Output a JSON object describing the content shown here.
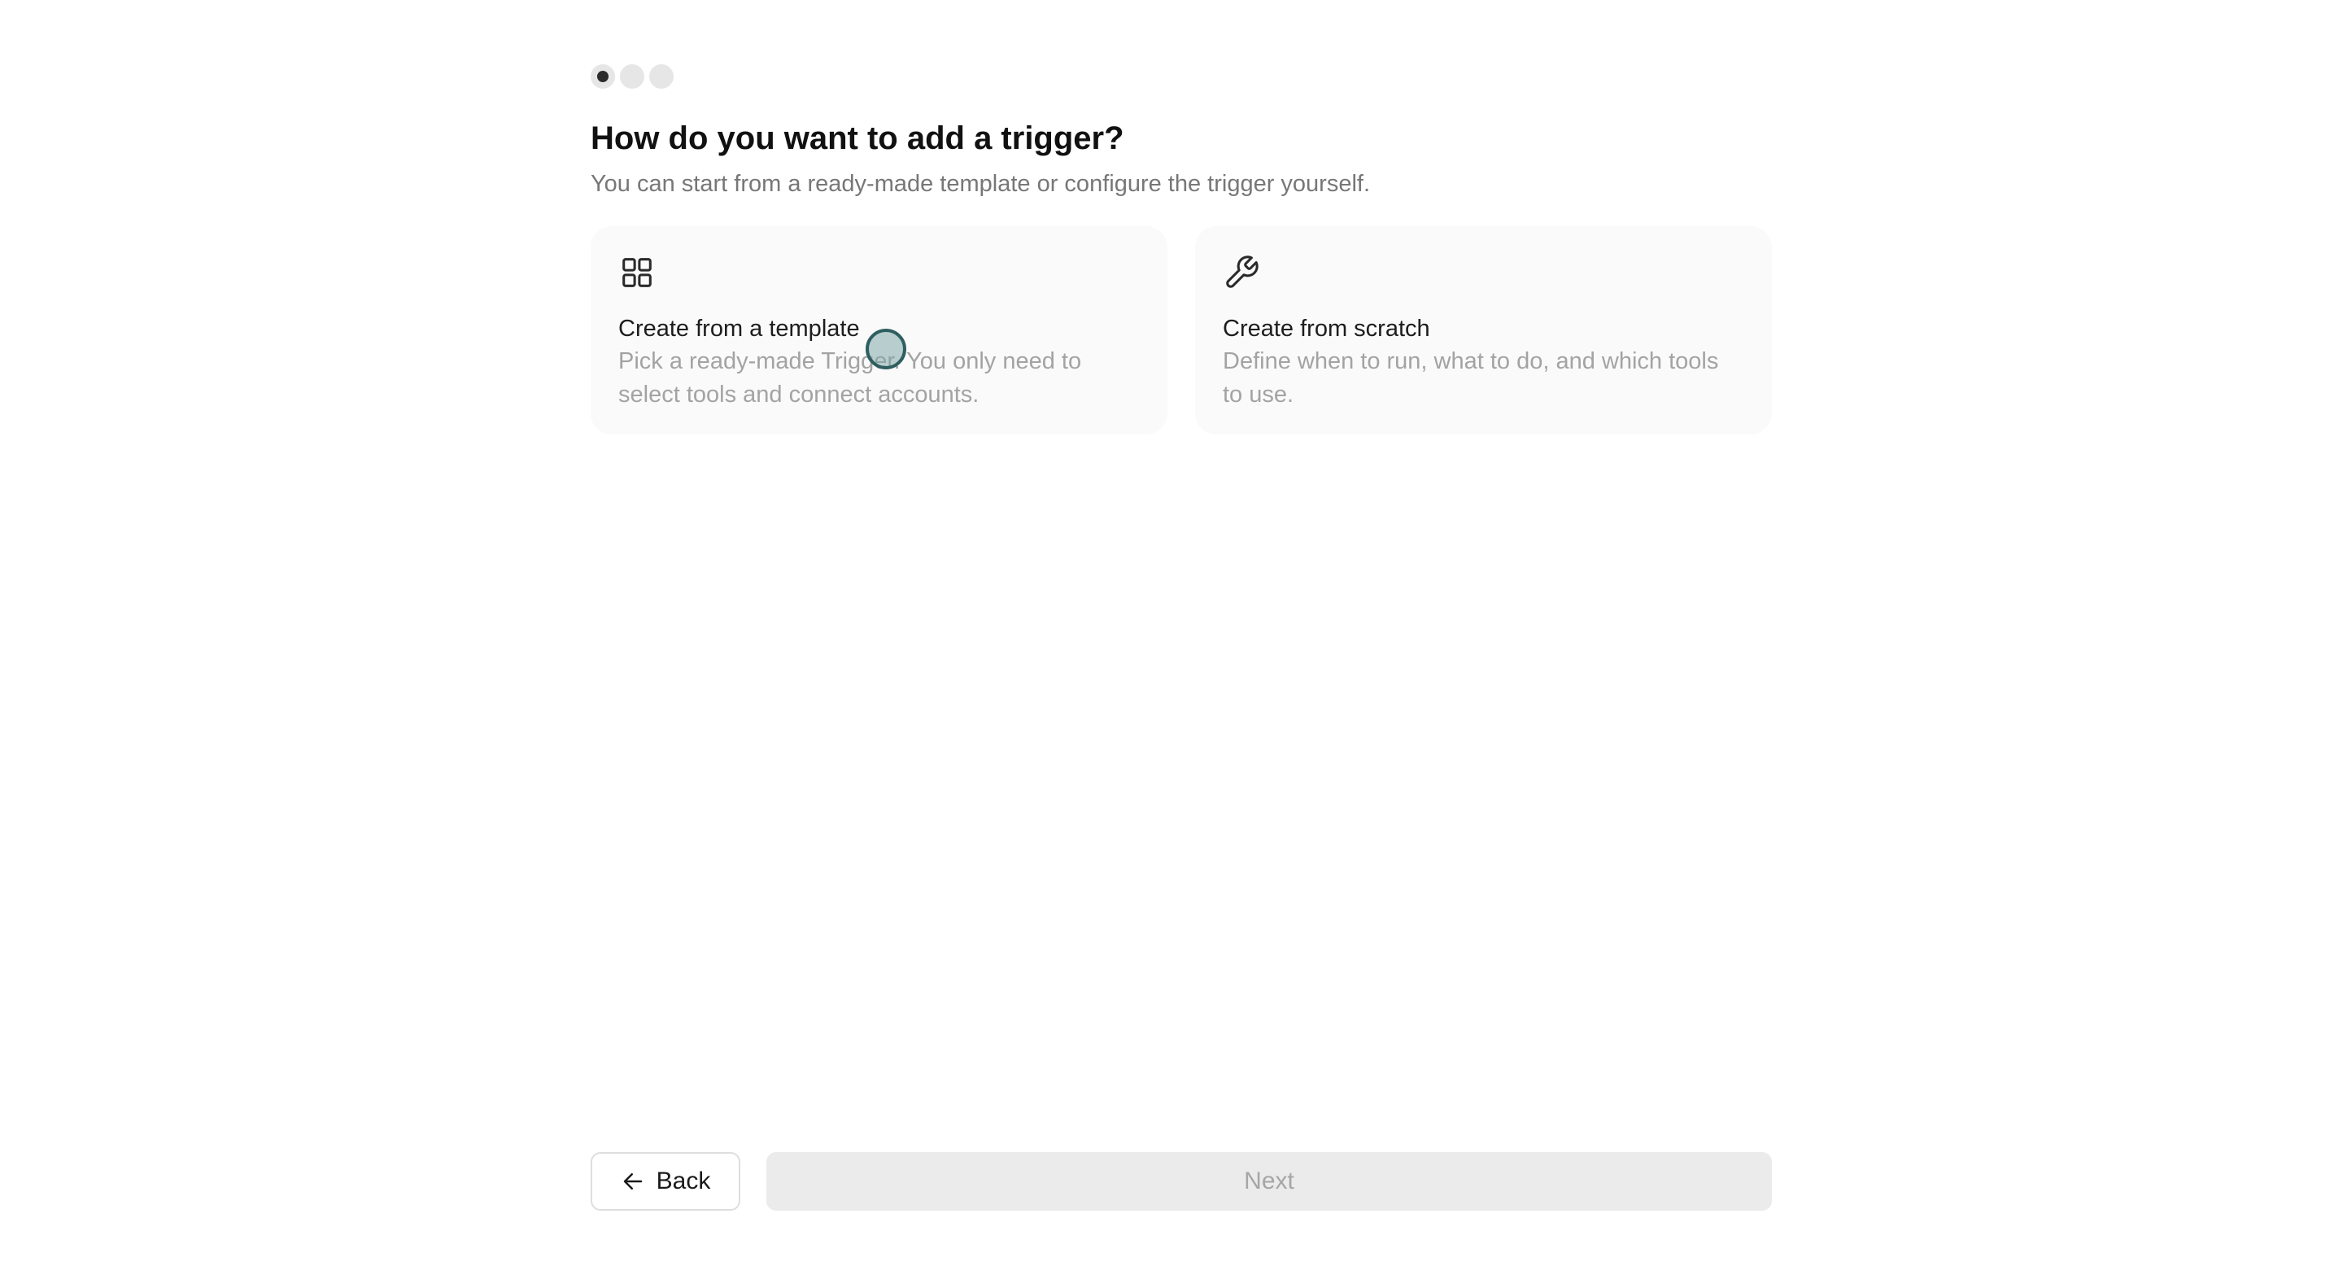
{
  "stepper": {
    "total_steps": 3,
    "current_step": 1
  },
  "header": {
    "title": "How do you want to add a trigger?",
    "subtitle": "You can start from a ready-made template or configure the trigger yourself."
  },
  "options": [
    {
      "icon": "grid-icon",
      "title": "Create from a template",
      "description": "Pick a ready-made Trigger. You only need to select tools and connect accounts."
    },
    {
      "icon": "wrench-icon",
      "title": "Create from scratch",
      "description": "Define when to run, what to do, and which tools to use."
    }
  ],
  "footer": {
    "back_label": "Back",
    "back_icon": "arrow-left-icon",
    "next_label": "Next",
    "next_enabled": false
  },
  "colors": {
    "card_background": "#fafafa",
    "active_step": "#2b2b2b",
    "inactive_step": "#e6e6e6",
    "disabled_button": "#ebebeb"
  }
}
